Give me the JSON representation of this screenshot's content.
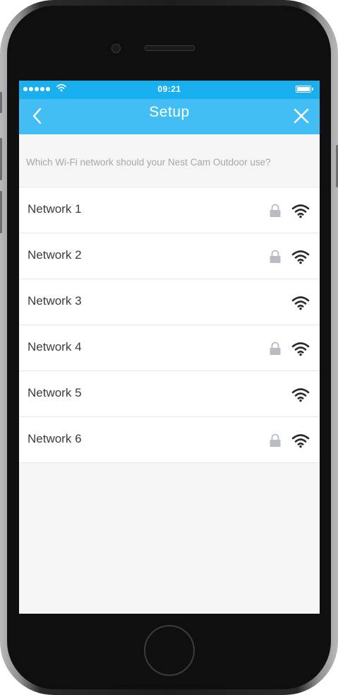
{
  "status_bar": {
    "time": "09:21",
    "signal_bars": 5,
    "wifi_icon": "wifi-icon",
    "battery_icon": "battery-full-icon",
    "color": "#1ab0ef"
  },
  "nav": {
    "title": "Setup",
    "back_icon": "chevron-left-icon",
    "close_icon": "close-icon",
    "color": "#42bef5"
  },
  "prompt": "Which Wi-Fi network should your Nest Cam Outdoor use?",
  "networks": [
    {
      "name": "Network 1",
      "locked": true
    },
    {
      "name": "Network 2",
      "locked": true
    },
    {
      "name": "Network 3",
      "locked": false
    },
    {
      "name": "Network 4",
      "locked": true
    },
    {
      "name": "Network 5",
      "locked": false
    },
    {
      "name": "Network 6",
      "locked": true
    }
  ]
}
